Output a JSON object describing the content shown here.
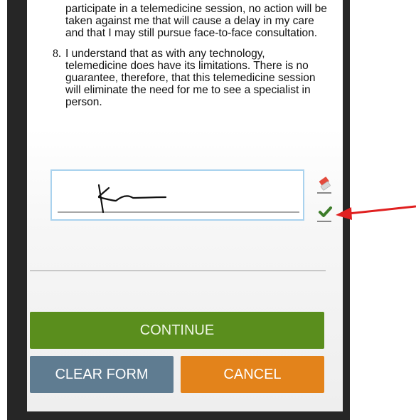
{
  "consent": {
    "clause_7_tail": "participate in a telemedicine session, no action will be taken against me that will cause a delay in my care and that I may still pursue face-to-face consultation.",
    "clause_8": {
      "number": "8.",
      "text": "I understand that as with any technology, telemedicine does have its limitations. There is no guarantee, therefore, that this telemedicine session will eliminate the need for me to see a specialist in person."
    }
  },
  "signature": {
    "eraser_icon": "eraser-icon",
    "confirm_icon": "checkmark-icon"
  },
  "buttons": {
    "continue": "CONTINUE",
    "clear_form": "CLEAR FORM",
    "cancel": "CANCEL"
  },
  "colors": {
    "continue": "#5a8e1d",
    "clear_form": "#5f7c91",
    "cancel": "#e3831b",
    "signature_border": "#a9d2ee",
    "annotation_arrow": "#e02020",
    "checkmark": "#3d7d2a"
  }
}
